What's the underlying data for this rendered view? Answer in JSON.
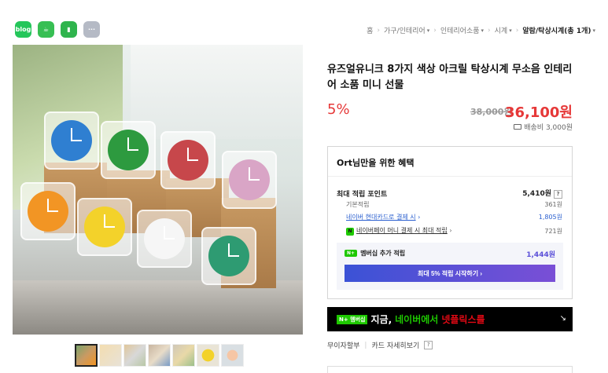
{
  "share": {
    "blog_label": "blog",
    "icons": [
      "blog-icon",
      "cafe-icon",
      "bookmark-icon",
      "more-icon"
    ]
  },
  "breadcrumb": {
    "home": "홈",
    "c1": "가구/인테리어",
    "c2": "인테리어소품",
    "c3": "시계",
    "current": "알람/탁상시계(총 1개)"
  },
  "product": {
    "title": "유즈얼유니크 8가지 색상 아크릴 탁상시계 무소음 인테리어 소품 미니 선물",
    "discount": "5%",
    "original_price": "38,000원",
    "sale_price": "36,100원",
    "shipping": "배송비 3,000원"
  },
  "benefit": {
    "heading": "Ort님만을 위한 혜택",
    "max_points_label": "최대 적립 포인트",
    "max_points_value": "5,410원",
    "help": "?",
    "basic_label": "기본적립",
    "basic_value": "361원",
    "card_label": "네이버 현대카드로 결제 시",
    "card_value": "1,805원",
    "npay_label": "네이버페이 머니 결제 시 최대 적립",
    "npay_value": "721원",
    "npay_badge": "N",
    "member_badge": "N+",
    "member_label": "멤버십 추가 적립",
    "member_value": "1,444원",
    "member_button": "최대 5% 적립 시작하기 ›"
  },
  "banner": {
    "tag": "N+ 멤버십",
    "t1": "지금,",
    "t2": "네이버에서",
    "t3": "넷플릭스를"
  },
  "install": {
    "label": "무이자할부",
    "detail": "카드 자세히보기",
    "help": "?"
  },
  "colors": {
    "accent_red": "#e63838",
    "naver_green": "#1ec800",
    "link_blue": "#2a5fcf"
  }
}
